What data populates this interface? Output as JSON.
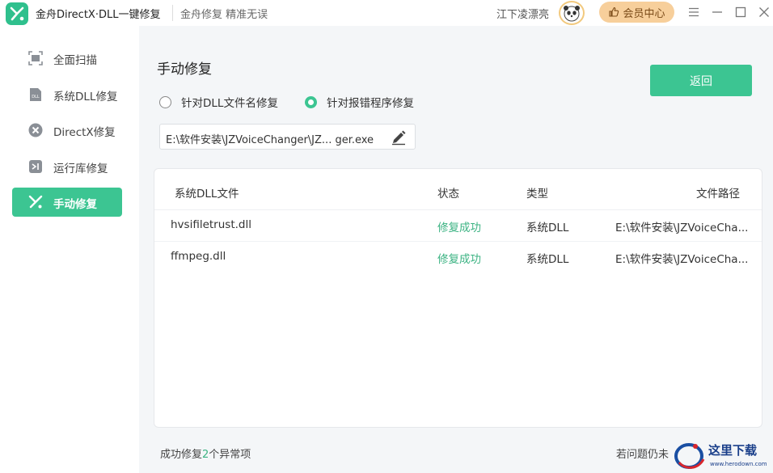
{
  "titlebar": {
    "app_title": "金舟DirectX·DLL一键修复",
    "slogan": "金舟修复 精准无误",
    "username": "江下凌漂亮",
    "vip_label": "会员中心"
  },
  "sidebar": {
    "items": [
      {
        "label": "全面扫描",
        "icon": "scan-icon",
        "active": false
      },
      {
        "label": "系统DLL修复",
        "icon": "dll-file-icon",
        "active": false
      },
      {
        "label": "DirectX修复",
        "icon": "directx-icon",
        "active": false
      },
      {
        "label": "运行库修复",
        "icon": "runtime-icon",
        "active": false
      },
      {
        "label": "手动修复",
        "icon": "tools-icon",
        "active": true
      }
    ]
  },
  "main": {
    "title": "手动修复",
    "back_label": "返回",
    "radio_options": [
      {
        "label": "针对DLL文件名修复",
        "checked": false
      },
      {
        "label": "针对报错程序修复",
        "checked": true
      }
    ],
    "path_value": "E:\\软件安装\\JZVoiceChanger\\JZ...  ger.exe",
    "table": {
      "headers": [
        "系统DLL文件",
        "状态",
        "类型",
        "文件路径"
      ],
      "rows": [
        {
          "file": "hvsifiletrust.dll",
          "status": "修复成功",
          "type": "系统DLL",
          "path": "E:\\软件安装\\JZVoiceCha..."
        },
        {
          "file": "ffmpeg.dll",
          "status": "修复成功",
          "type": "系统DLL",
          "path": "E:\\软件安装\\JZVoiceCha..."
        }
      ]
    },
    "footer": {
      "prefix": "成功修复",
      "count": "2",
      "suffix": "个异常项",
      "right_text": "若问题仍未"
    }
  },
  "watermark": {
    "text": "这里下载",
    "url": "www.herodown.com"
  },
  "colors": {
    "accent": "#3cc592",
    "success_text": "#3cb383",
    "vip_bg": "#f7cf9b"
  }
}
